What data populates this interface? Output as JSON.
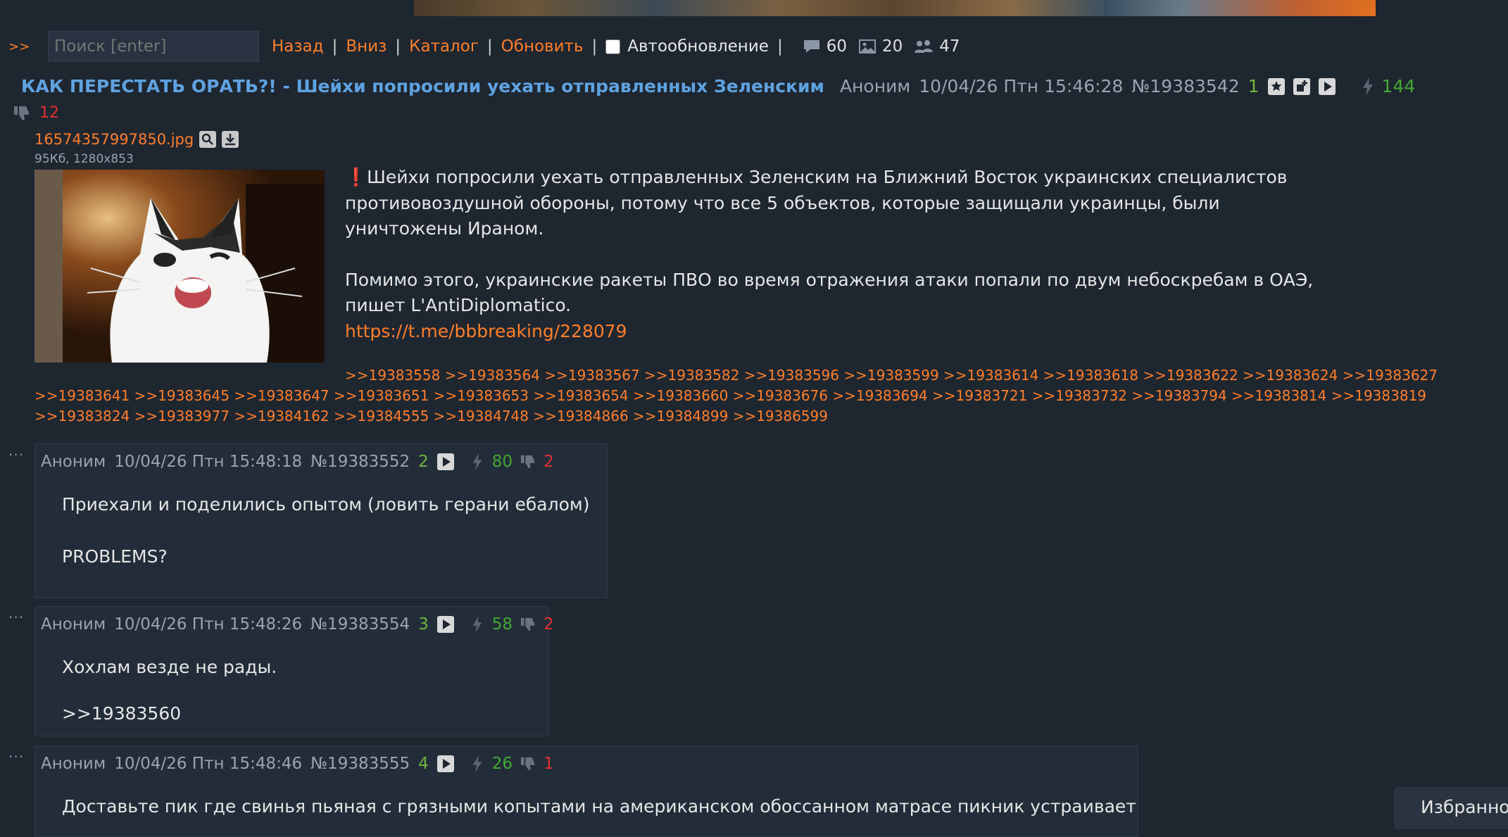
{
  "nav": {
    "arrows": ">>",
    "search_placeholder": "Поиск [enter]",
    "links": [
      "Назад",
      "Вниз",
      "Каталог",
      "Обновить"
    ],
    "autoupdate_label": "Автообновление",
    "posts_count": "60",
    "images_count": "20",
    "users_count": "47"
  },
  "op": {
    "subject": "КАК ПЕРЕСТАТЬ ОРАТЬ?! - Шейхи попросили уехать отправленных Зеленским",
    "author": "Аноним",
    "datetime": "10/04/26 Птн 15:46:28",
    "number": "№19383542",
    "index": "1",
    "likes": "144",
    "dislikes": "12",
    "file_name": "16574357997850.jpg",
    "file_info": "95Кб, 1280x853",
    "excl": "❗",
    "text_1": "Шейхи попросили уехать отправленных Зеленским на Ближний Восток украинских специалистов",
    "text_2": "противовоздушной обороны, потому что все 5 объектов, которые защищали украинцы, были",
    "text_3": "уничтожены Ираном.",
    "text_4": "Помимо этого, украинские ракеты ПВО во время отражения атаки попали по двум небоскребам в ОАЭ,",
    "text_5": "пишет L'AntiDiplomatico.",
    "link": "https://t.me/bbbreaking/228079",
    "replies_line1": ">>19383558 >>19383564 >>19383567 >>19383582 >>19383596 >>19383599 >>19383614 >>19383618 >>19383622 >>19383624 >>19383627",
    "replies_line2": ">>19383641 >>19383645 >>19383647 >>19383651 >>19383653 >>19383654 >>19383660 >>19383676 >>19383694 >>19383721 >>19383732 >>19383794 >>19383814 >>19383819",
    "replies_line3": ">>19383824 >>19383977 >>19384162 >>19384555 >>19384748 >>19384866 >>19384899 >>19386599"
  },
  "posts": [
    {
      "dots": "···",
      "author": "Аноним",
      "datetime": "10/04/26 Птн 15:48:18",
      "number": "№19383552",
      "index": "2",
      "likes": "80",
      "dislikes": "2",
      "line1": "Приехали и поделились опытом (ловить герани ебалом)",
      "line2": "PROBLEMS?"
    },
    {
      "dots": "···",
      "author": "Аноним",
      "datetime": "10/04/26 Птн 15:48:26",
      "number": "№19383554",
      "index": "3",
      "likes": "58",
      "dislikes": "2",
      "line1": "Хохлам везде не рады.",
      "ref": ">>19383560"
    },
    {
      "dots": "···",
      "author": "Аноним",
      "datetime": "10/04/26 Птн 15:48:46",
      "number": "№19383555",
      "index": "4",
      "likes": "26",
      "dislikes": "1",
      "line1": "Доставьте пик где свинья пьяная с грязными копытами на американском обоссанном матрасе пикник устраивает"
    }
  ],
  "favorites": "Избранное"
}
